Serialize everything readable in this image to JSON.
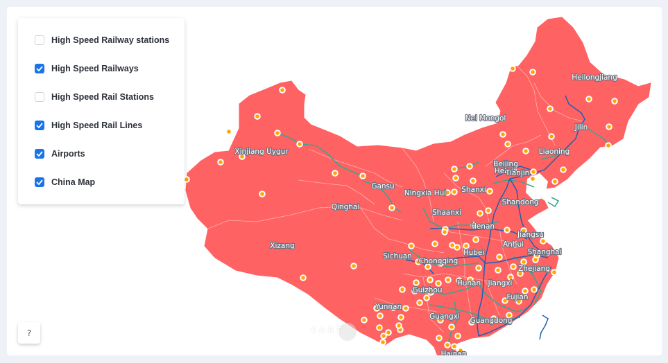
{
  "layers_panel": {
    "items": [
      {
        "label": "High Speed Railway stations",
        "checked": false
      },
      {
        "label": "High Speed Railways",
        "checked": true
      },
      {
        "label": "High Speed Rail Stations",
        "checked": false
      },
      {
        "label": "High Speed Rail Lines",
        "checked": true
      },
      {
        "label": "Airports",
        "checked": true
      },
      {
        "label": "China Map",
        "checked": true
      }
    ]
  },
  "help_button": {
    "label": "?"
  },
  "attribution": {
    "label": "CART"
  },
  "colors": {
    "land": "#ff6262",
    "border": "#ffb0b0",
    "airport_fill": "#ffa500",
    "airport_ring": "#ffffff",
    "hsr_line": "#1f5fb0",
    "railway": "#3aa58f",
    "checkbox": "#1a73e8",
    "background": "#eef1f6"
  },
  "province_labels": [
    {
      "name": "Heilongjiang"
    },
    {
      "name": "Nei Mongol"
    },
    {
      "name": "Jilin"
    },
    {
      "name": "Liaoning"
    },
    {
      "name": "Beijing"
    },
    {
      "name": "Hebei"
    },
    {
      "name": "Tianjin"
    },
    {
      "name": "Xinjiang Uygur"
    },
    {
      "name": "Gansu"
    },
    {
      "name": "Ningxia Hui"
    },
    {
      "name": "Shanxi"
    },
    {
      "name": "Qinghai"
    },
    {
      "name": "Shaanxi"
    },
    {
      "name": "Shandong"
    },
    {
      "name": "Henan"
    },
    {
      "name": "Jiangsu"
    },
    {
      "name": "Xizang"
    },
    {
      "name": "Anhui"
    },
    {
      "name": "Shanghai"
    },
    {
      "name": "Sichuan"
    },
    {
      "name": "Hubei"
    },
    {
      "name": "Chongqing"
    },
    {
      "name": "Zhejiang"
    },
    {
      "name": "Hunan"
    },
    {
      "name": "Jiangxi"
    },
    {
      "name": "Guizhou"
    },
    {
      "name": "Fujian"
    },
    {
      "name": "Yunnan"
    },
    {
      "name": "Guangxi"
    },
    {
      "name": "Guangdong"
    },
    {
      "name": "Hainan"
    }
  ]
}
